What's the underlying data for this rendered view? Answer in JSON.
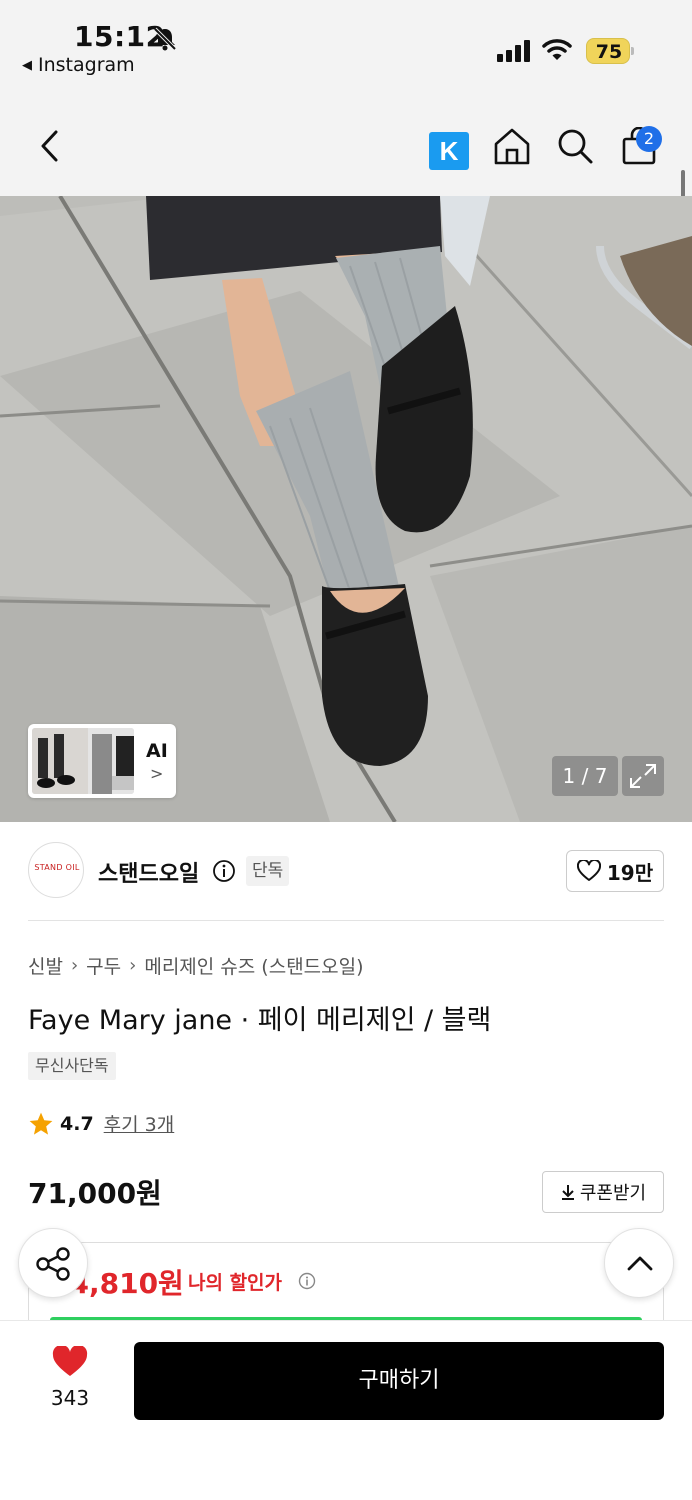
{
  "status_bar": {
    "time": "15:12",
    "back_app": "Instagram",
    "battery": "75"
  },
  "header": {
    "cart_count": "2"
  },
  "gallery": {
    "ai_label": "AI",
    "counter": "1 / 7"
  },
  "brand": {
    "logo_text": "STAND OIL",
    "name": "스탠드오일",
    "exclusive_tag": "단독",
    "likes": "19만"
  },
  "breadcrumb": [
    "신발",
    "구두",
    "메리제인 슈즈 (스탠드오일)"
  ],
  "product": {
    "title": "Faye Mary jane · 페이 메리제인 / 블랙",
    "store_tag": "무신사단독",
    "rating": "4.7",
    "reviews": "후기 3개",
    "price": "71,000원",
    "coupon_label": "쿠폰받기",
    "discount_price": "64,810원",
    "discount_label": "나의 할인가"
  },
  "bottom": {
    "like_count": "343",
    "buy_label": "구매하기"
  },
  "colors": {
    "accent_red": "#e0262b",
    "k_blue": "#1a9bf0",
    "badge_blue": "#1f6fe8",
    "green_bar": "#2fcf5f"
  }
}
